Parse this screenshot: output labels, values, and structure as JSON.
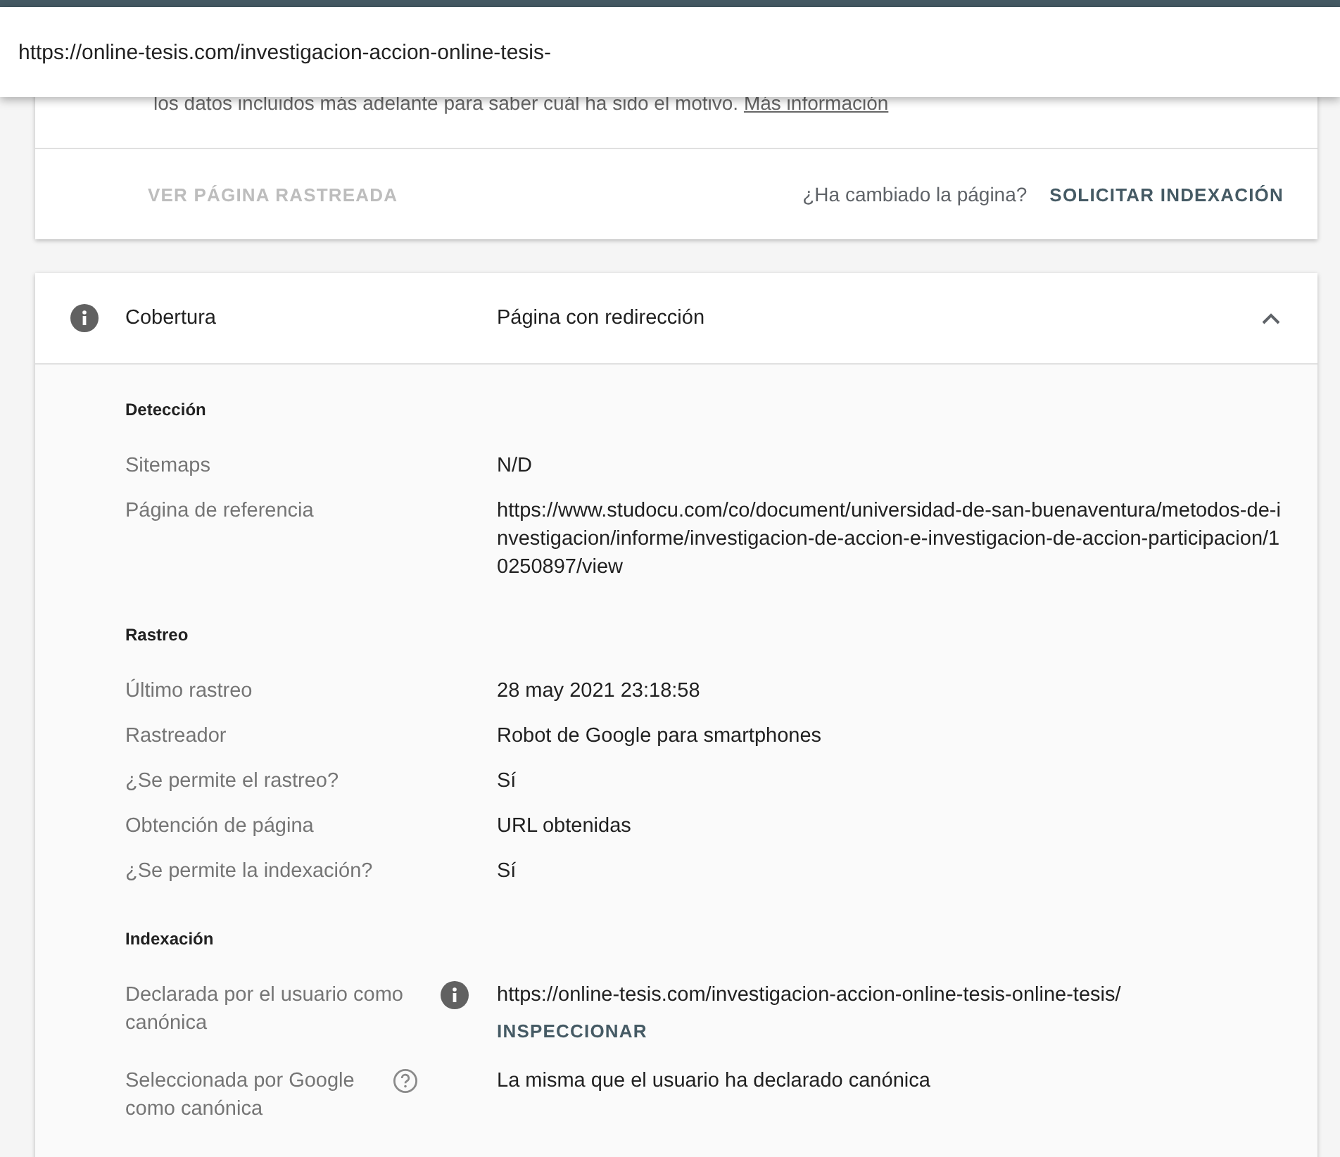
{
  "url_bar": {
    "value": "https://online-tesis.com/investigacion-accion-online-tesis-"
  },
  "status_card": {
    "text": "los datos incluidos más adelante para saber cuál ha sido el motivo.",
    "link": "Más información",
    "view_button": {
      "label": "VER PÁGINA RASTREADA",
      "disabled": true
    },
    "question": "¿Ha cambiado la página?",
    "request_button": {
      "label": "SOLICITAR INDEXACIÓN",
      "disabled": false
    }
  },
  "coverage": {
    "title": "Cobertura",
    "status": "Página con redirección",
    "expanded": true,
    "sections": [
      {
        "heading": "Detección",
        "rows": [
          {
            "label": "Sitemaps",
            "value": "N/D"
          },
          {
            "label": "Página de referencia",
            "value": "https://www.studocu.com/co/document/universidad-de-san-buenaventura/metodos-de-investigacion/informe/investigacion-de-accion-e-investigacion-de-accion-participacion/10250897/view"
          }
        ]
      },
      {
        "heading": "Rastreo",
        "rows": [
          {
            "label": "Último rastreo",
            "value": "28 may 2021 23:18:58"
          },
          {
            "label": "Rastreador",
            "value": "Robot de Google para smartphones"
          },
          {
            "label": "¿Se permite el rastreo?",
            "value": "Sí"
          },
          {
            "label": "Obtención de página",
            "value": "URL obtenidas"
          },
          {
            "label": "¿Se permite la indexación?",
            "value": "Sí"
          }
        ]
      },
      {
        "heading": "Indexación",
        "rows": [
          {
            "label": "Declarada por el usuario como canónica",
            "kind": "info",
            "value": "https://online-tesis.com/investigacion-accion-online-tesis-online-tesis/",
            "action": "INSPECCIONAR"
          },
          {
            "label": "Seleccionada por Google como canónica",
            "kind": "help",
            "value": "La misma que el usuario ha declarado canónica"
          }
        ]
      }
    ]
  }
}
